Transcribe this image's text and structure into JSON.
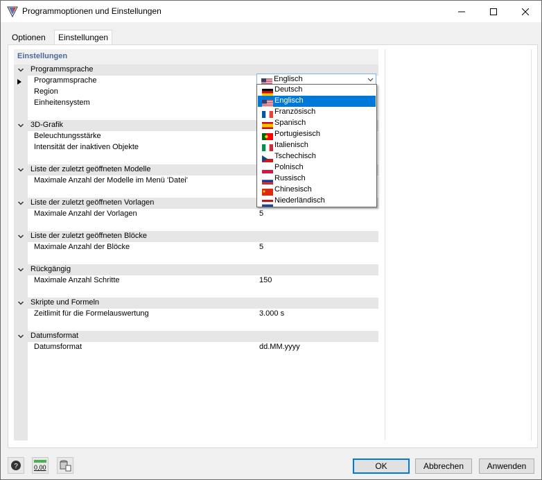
{
  "window": {
    "title": "Programmoptionen und Einstellungen"
  },
  "tabs": [
    {
      "label": "Optionen"
    },
    {
      "label": "Einstellungen"
    }
  ],
  "settings_header": "Einstellungen",
  "categories": [
    {
      "label": "Programmsprache",
      "rows": [
        {
          "name": "Programmsprache",
          "value": ""
        },
        {
          "name": "Region",
          "value": ""
        },
        {
          "name": "Einheitensystem",
          "value": ""
        }
      ]
    },
    {
      "label": "3D-Grafik",
      "rows": [
        {
          "name": "Beleuchtungsstärke",
          "value": ""
        },
        {
          "name": "Intensität der inaktiven Objekte",
          "value": ""
        }
      ]
    },
    {
      "label": "Liste der zuletzt geöffneten Modelle",
      "rows": [
        {
          "name": "Maximale Anzahl der Modelle im Menü 'Datei'",
          "value": ""
        }
      ]
    },
    {
      "label": "Liste der zuletzt geöffneten Vorlagen",
      "rows": [
        {
          "name": "Maximale Anzahl der Vorlagen",
          "value": "5"
        }
      ]
    },
    {
      "label": "Liste der zuletzt geöffneten Blöcke",
      "rows": [
        {
          "name": "Maximale Anzahl der Blöcke",
          "value": "5"
        }
      ]
    },
    {
      "label": "Rückgängig",
      "rows": [
        {
          "name": "Maximale Anzahl Schritte",
          "value": "150"
        }
      ]
    },
    {
      "label": "Skripte und Formeln",
      "rows": [
        {
          "name": "Zeitlimit für die Formelauswertung",
          "value": "3.000 s"
        }
      ]
    },
    {
      "label": "Datumsformat",
      "rows": [
        {
          "name": "Datumsformat",
          "value": "dd.MM.yyyy"
        }
      ]
    }
  ],
  "language_combo": {
    "selected": "Englisch",
    "options": [
      {
        "label": "Deutsch",
        "flag": "flag-de"
      },
      {
        "label": "Englisch",
        "flag": "flag-us"
      },
      {
        "label": "Französisch",
        "flag": "flag-fr"
      },
      {
        "label": "Spanisch",
        "flag": "flag-es"
      },
      {
        "label": "Portugiesisch",
        "flag": "flag-pt"
      },
      {
        "label": "Italienisch",
        "flag": "flag-it"
      },
      {
        "label": "Tschechisch",
        "flag": "flag-cz"
      },
      {
        "label": "Polnisch",
        "flag": "flag-pl"
      },
      {
        "label": "Russisch",
        "flag": "flag-ru"
      },
      {
        "label": "Chinesisch",
        "flag": "flag-cn"
      },
      {
        "label": "Niederländisch",
        "flag": "flag-nl"
      }
    ]
  },
  "footer": {
    "units_icon_text": "0,00",
    "ok": "OK",
    "cancel": "Abbrechen",
    "apply": "Anwenden"
  },
  "colors": {
    "accent": "#0078d7",
    "category_bg": "#e6e6e6",
    "section_title": "#4a6a9a"
  }
}
